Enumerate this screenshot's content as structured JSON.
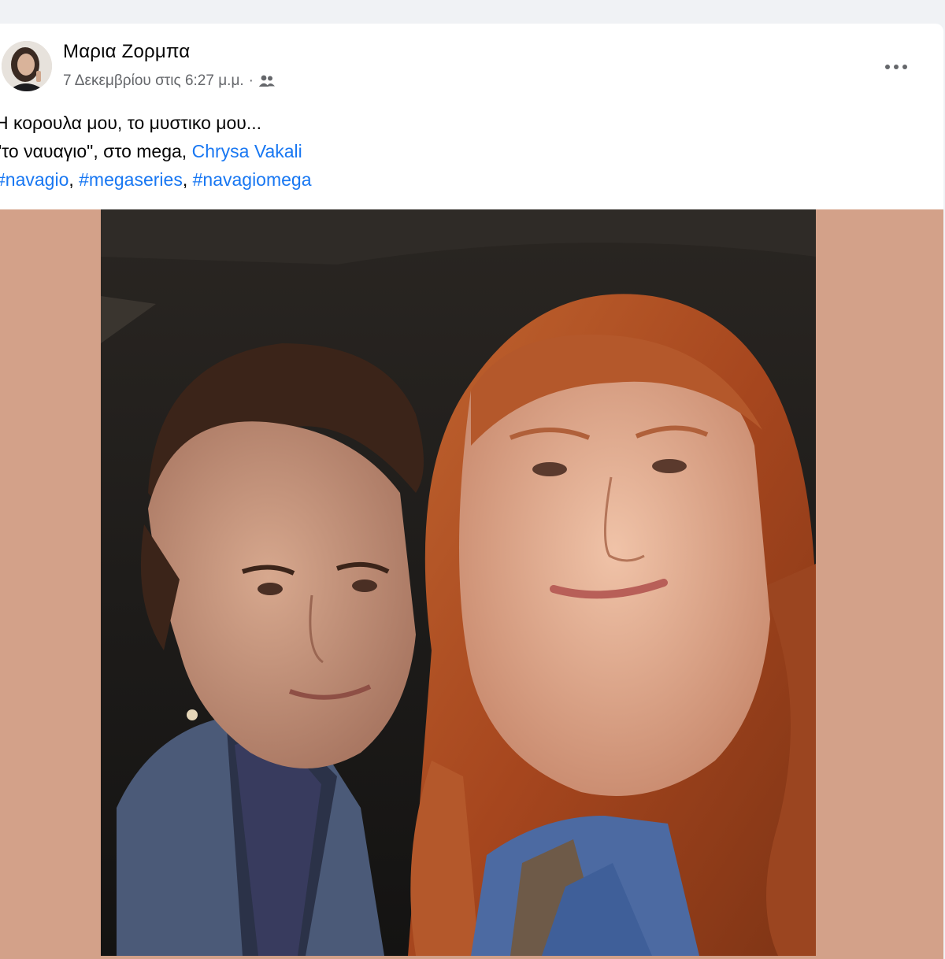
{
  "post": {
    "author": "Μαρια Ζορμπα",
    "timestamp": "7 Δεκεμβρίου στις 6:27 μ.μ.",
    "separator": "·",
    "audience_icon": "friends-icon",
    "more_icon": "more-options-icon",
    "text": {
      "line1": "Η κορουλα μου, το μυστικο μου...",
      "line2_prefix": "\"το ναυαγιο\", στο mega,",
      "mention": "Chrysa Vakali",
      "hashtags": [
        "#navagio",
        "#megaseries",
        "#navagiomega"
      ],
      "hashtag_separator": ", "
    }
  },
  "colors": {
    "link": "#1877f2",
    "photo_matte": "#d3a189",
    "secondary_text": "#65676b"
  }
}
